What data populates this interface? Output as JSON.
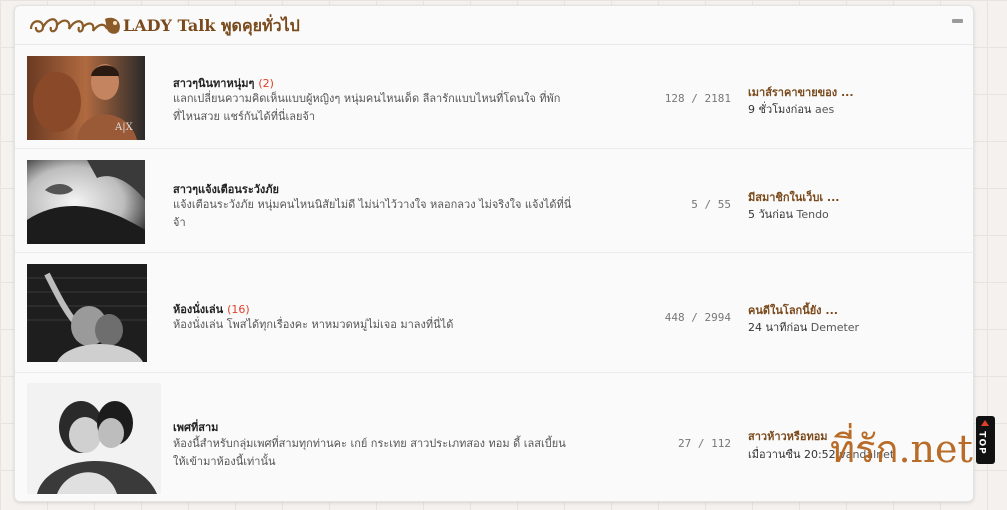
{
  "header": {
    "title": "LADY Talk พูดคุยทั่วไป",
    "logo_icon": "ornamental-flourish-logo",
    "collapse_icon": "minus-icon"
  },
  "forums": [
    {
      "title": "สาวๆนินทาหนุ่มๆ",
      "count": "(2)",
      "description": "แลกเปลี่ยนความคิดเห็นแบบผู้หญิงๆ หนุ่มคนไหนเด็ด ลีลารักแบบไหนที่โดนใจ ที่พักที่ไหนสวย แชร์กันได้ที่นี่เลยจ้า",
      "topics": "128",
      "posts": "2181",
      "last_title": "เมาส์ราคาขายของ ...",
      "last_time": "9 ชั่วโมงก่อน",
      "last_user": "aes"
    },
    {
      "title": "สาวๆแจ้งเตือนระวังภัย",
      "count": "",
      "description": "แจ้งเตือนระวังภัย หนุ่มคนไหนนิสัยไม่ดี ไม่น่าไว้วางใจ หลอกลวง ไม่จริงใจ แจ้งได้ที่นี่จ้า",
      "topics": "5",
      "posts": "55",
      "last_title": "มีสมาชิกในเว็บเ ...",
      "last_time": "5 วันก่อน",
      "last_user": "Tendo"
    },
    {
      "title": "ห้องนั่งเล่น",
      "count": "(16)",
      "description": "ห้องนั่งเล่น โพสได้ทุกเรื่องคะ หาหมวดหมู่ไม่เจอ มาลงที่นี่ได้",
      "topics": "448",
      "posts": "2994",
      "last_title": "คนดีในโลกนี้ยัง ...",
      "last_time": "24 นาทีก่อน",
      "last_user": "Demeter"
    },
    {
      "title": "เพศที่สาม",
      "count": "",
      "description": "ห้องนี้สำหรับกลุ่มเพศที่สามทุกท่านคะ เกย์ กระเทย สาวประเภทสอง ทอม ดี้ เลสเบี้ยน ให้เข้ามาห้องนี้เท่านั้น",
      "topics": "27",
      "posts": "112",
      "last_title": "สาวห้าวหรือทอม",
      "last_time": "เมื่อวานซืน 20:52",
      "last_user": "vandalnet"
    }
  ],
  "separator": "/",
  "watermark": "ที่รัก.net",
  "top_button": "TOP",
  "colors": {
    "accent": "#7a4a1c",
    "count_red": "#e0402a",
    "watermark": "#b5651d"
  }
}
